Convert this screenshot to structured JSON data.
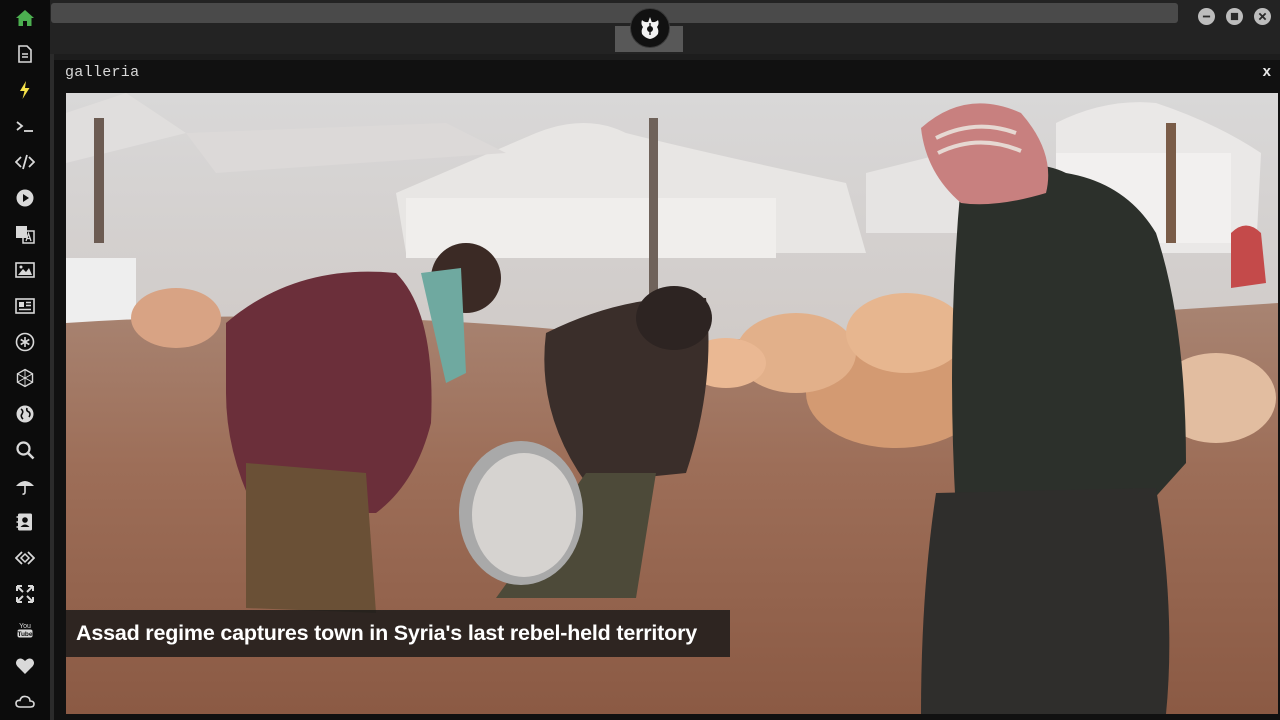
{
  "colors": {
    "sidebar_bg": "#0c0c0c",
    "accent_home": "#4caf50",
    "accent_flash": "#f6e24a",
    "icon": "#d9d9d9"
  },
  "sidebar": {
    "items": [
      {
        "icon": "home-icon"
      },
      {
        "icon": "document-icon"
      },
      {
        "icon": "lightning-icon"
      },
      {
        "icon": "terminal-icon"
      },
      {
        "icon": "code-icon"
      },
      {
        "icon": "play-icon"
      },
      {
        "icon": "translate-icon"
      },
      {
        "icon": "image-icon"
      },
      {
        "icon": "newspaper-icon"
      },
      {
        "icon": "asterisk-icon"
      },
      {
        "icon": "hexagon-icon"
      },
      {
        "icon": "globe-icon"
      },
      {
        "icon": "search-icon"
      },
      {
        "icon": "umbrella-icon"
      },
      {
        "icon": "contact-icon"
      },
      {
        "icon": "code-diamond-icon"
      },
      {
        "icon": "expand-icon"
      },
      {
        "icon": "youtube-icon"
      },
      {
        "icon": "heart-icon"
      },
      {
        "icon": "cloud-icon"
      }
    ]
  },
  "window_controls": [
    "minimize-icon",
    "maximize-icon",
    "close-icon"
  ],
  "top_logo": {
    "icon": "rebel-alliance-icon"
  },
  "panel": {
    "title": "galleria",
    "close_label": "x"
  },
  "gallery": {
    "caption": "Assad regime captures town in Syria's last rebel-held territory"
  }
}
